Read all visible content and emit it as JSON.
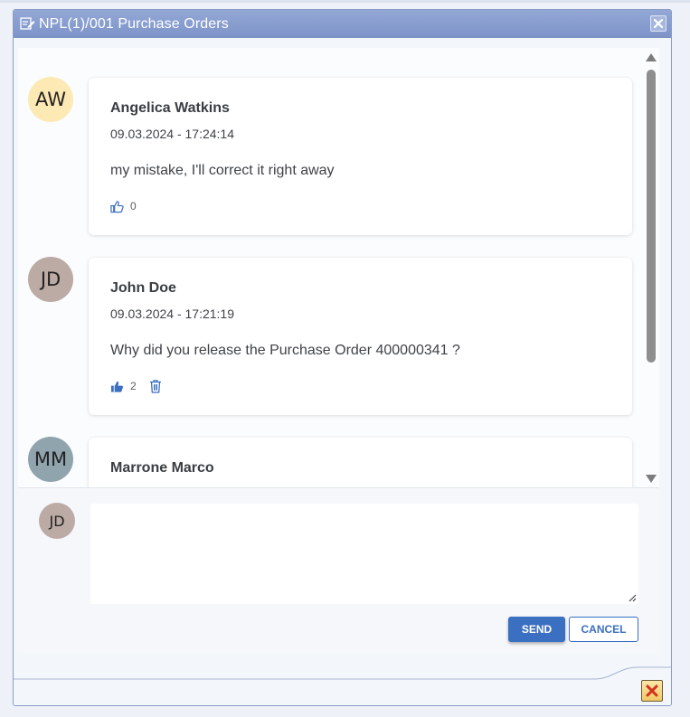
{
  "window": {
    "title": "NPL(1)/001 Purchase Orders"
  },
  "comments": [
    {
      "initials": "AW",
      "avatar_color": "#fde9b3",
      "author": "Angelica Watkins",
      "timestamp": "09.03.2024 - 17:24:14",
      "text": "my mistake, I'll correct it right away",
      "likes": "0",
      "liked": false
    },
    {
      "initials": "JD",
      "avatar_color": "#bcaaa4",
      "author": "John Doe",
      "timestamp": "09.03.2024 - 17:21:19",
      "text": "Why did you release the Purchase Order 400000341 ?",
      "likes": "2",
      "liked": true
    },
    {
      "initials": "MM",
      "avatar_color": "#90a4ae",
      "author": "Marrone Marco"
    }
  ],
  "composer": {
    "initials": "JD",
    "avatar_color": "#bcaaa4",
    "value": "",
    "send_label": "SEND",
    "cancel_label": "CANCEL"
  },
  "colors": {
    "accent": "#3b6fc2",
    "titlebar": "#8ba0d2"
  },
  "icons": {
    "title": "edit-document-icon",
    "like": "thumbs-up-icon",
    "delete": "trash-icon",
    "close": "close-icon"
  }
}
